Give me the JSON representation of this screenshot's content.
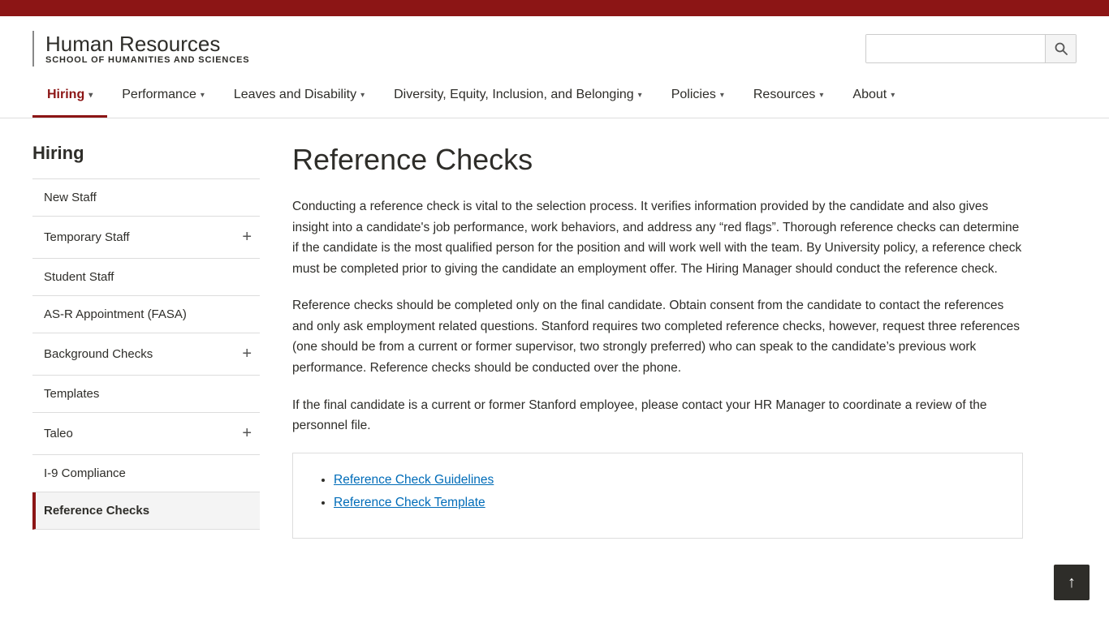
{
  "top_bar": {},
  "header": {
    "divider": true,
    "title": "Human Resources",
    "subtitle": "School of Humanities and Sciences",
    "search_placeholder": ""
  },
  "nav": {
    "items": [
      {
        "label": "Hiring",
        "active": true,
        "has_dropdown": true
      },
      {
        "label": "Performance",
        "active": false,
        "has_dropdown": true
      },
      {
        "label": "Leaves and Disability",
        "active": false,
        "has_dropdown": true
      },
      {
        "label": "Diversity, Equity, Inclusion, and Belonging",
        "active": false,
        "has_dropdown": true
      },
      {
        "label": "Policies",
        "active": false,
        "has_dropdown": true
      },
      {
        "label": "Resources",
        "active": false,
        "has_dropdown": true
      },
      {
        "label": "About",
        "active": false,
        "has_dropdown": true
      }
    ]
  },
  "sidebar": {
    "title": "Hiring",
    "items": [
      {
        "label": "New Staff",
        "has_plus": false,
        "active": false
      },
      {
        "label": "Temporary Staff",
        "has_plus": true,
        "active": false
      },
      {
        "label": "Student Staff",
        "has_plus": false,
        "active": false
      },
      {
        "label": "AS-R Appointment (FASA)",
        "has_plus": false,
        "active": false
      },
      {
        "label": "Background Checks",
        "has_plus": true,
        "active": false
      },
      {
        "label": "Templates",
        "has_plus": false,
        "active": false
      },
      {
        "label": "Taleo",
        "has_plus": true,
        "active": false
      },
      {
        "label": "I-9 Compliance",
        "has_plus": false,
        "active": false
      },
      {
        "label": "Reference Checks",
        "has_plus": false,
        "active": true
      }
    ]
  },
  "content": {
    "heading": "Reference Checks",
    "paragraph1": "Conducting a reference check is vital to the selection process. It verifies information provided by the candidate and also gives insight into a candidate's job performance, work behaviors, and address any “red flags”. Thorough reference checks can determine if the candidate is the most qualified person for the position and will work well with the team. By University policy, a reference check must be completed prior to giving the candidate an employment offer. The Hiring Manager should conduct the reference check.",
    "paragraph2": "Reference checks should be completed only on the final candidate.  Obtain consent from the candidate to contact the references and only ask employment related questions. Stanford requires two completed reference checks, however, request three references (one should be from a current or former supervisor, two strongly preferred) who can speak to the candidate’s previous work performance. Reference checks should be conducted over the phone.",
    "paragraph3": "If the final candidate is a current or former Stanford employee, please contact your HR Manager to coordinate a review of the personnel file.",
    "links": [
      {
        "label": "Reference Check Guidelines",
        "href": "#"
      },
      {
        "label": "Reference Check Template",
        "href": "#"
      }
    ]
  },
  "back_to_top_label": "↑"
}
